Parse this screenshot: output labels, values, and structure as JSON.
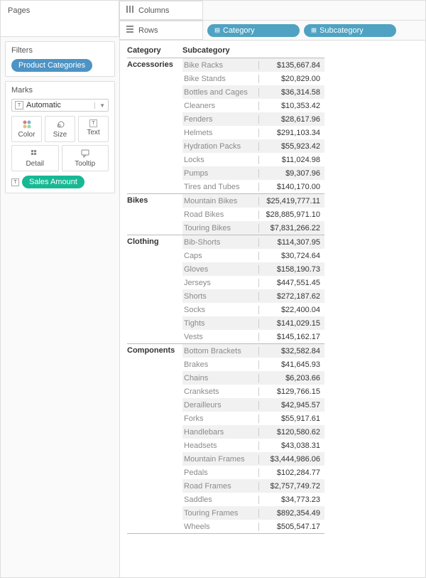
{
  "panels": {
    "pages": "Pages",
    "filters": "Filters",
    "marks": "Marks"
  },
  "filter_pill": "Product Categories",
  "marks_dropdown": "Automatic",
  "mark_cards": {
    "color": "Color",
    "size": "Size",
    "text": "Text",
    "detail": "Detail",
    "tooltip": "Tooltip"
  },
  "marks_field": "Sales Amount",
  "shelves": {
    "columns": "Columns",
    "rows": "Rows"
  },
  "row_pills": {
    "category": "Category",
    "subcategory": "Subcategory"
  },
  "headers": {
    "category": "Category",
    "subcategory": "Subcategory"
  },
  "data": [
    {
      "category": "Accessories",
      "rows": [
        {
          "sub": "Bike Racks",
          "val": "$135,667.84"
        },
        {
          "sub": "Bike Stands",
          "val": "$20,829.00"
        },
        {
          "sub": "Bottles and Cages",
          "val": "$36,314.58"
        },
        {
          "sub": "Cleaners",
          "val": "$10,353.42"
        },
        {
          "sub": "Fenders",
          "val": "$28,617.96"
        },
        {
          "sub": "Helmets",
          "val": "$291,103.34"
        },
        {
          "sub": "Hydration Packs",
          "val": "$55,923.42"
        },
        {
          "sub": "Locks",
          "val": "$11,024.98"
        },
        {
          "sub": "Pumps",
          "val": "$9,307.96"
        },
        {
          "sub": "Tires and Tubes",
          "val": "$140,170.00"
        }
      ]
    },
    {
      "category": "Bikes",
      "rows": [
        {
          "sub": "Mountain Bikes",
          "val": "$25,419,777.11"
        },
        {
          "sub": "Road Bikes",
          "val": "$28,885,971.10"
        },
        {
          "sub": "Touring Bikes",
          "val": "$7,831,266.22"
        }
      ]
    },
    {
      "category": "Clothing",
      "rows": [
        {
          "sub": "Bib-Shorts",
          "val": "$114,307.95"
        },
        {
          "sub": "Caps",
          "val": "$30,724.64"
        },
        {
          "sub": "Gloves",
          "val": "$158,190.73"
        },
        {
          "sub": "Jerseys",
          "val": "$447,551.45"
        },
        {
          "sub": "Shorts",
          "val": "$272,187.62"
        },
        {
          "sub": "Socks",
          "val": "$22,400.04"
        },
        {
          "sub": "Tights",
          "val": "$141,029.15"
        },
        {
          "sub": "Vests",
          "val": "$145,162.17"
        }
      ]
    },
    {
      "category": "Components",
      "rows": [
        {
          "sub": "Bottom Brackets",
          "val": "$32,582.84"
        },
        {
          "sub": "Brakes",
          "val": "$41,645.93"
        },
        {
          "sub": "Chains",
          "val": "$6,203.66"
        },
        {
          "sub": "Cranksets",
          "val": "$129,766.15"
        },
        {
          "sub": "Derailleurs",
          "val": "$42,945.57"
        },
        {
          "sub": "Forks",
          "val": "$55,917.61"
        },
        {
          "sub": "Handlebars",
          "val": "$120,580.62"
        },
        {
          "sub": "Headsets",
          "val": "$43,038.31"
        },
        {
          "sub": "Mountain Frames",
          "val": "$3,444,986.06"
        },
        {
          "sub": "Pedals",
          "val": "$102,284.77"
        },
        {
          "sub": "Road Frames",
          "val": "$2,757,749.72"
        },
        {
          "sub": "Saddles",
          "val": "$34,773.23"
        },
        {
          "sub": "Touring Frames",
          "val": "$892,354.49"
        },
        {
          "sub": "Wheels",
          "val": "$505,547.17"
        }
      ]
    }
  ]
}
